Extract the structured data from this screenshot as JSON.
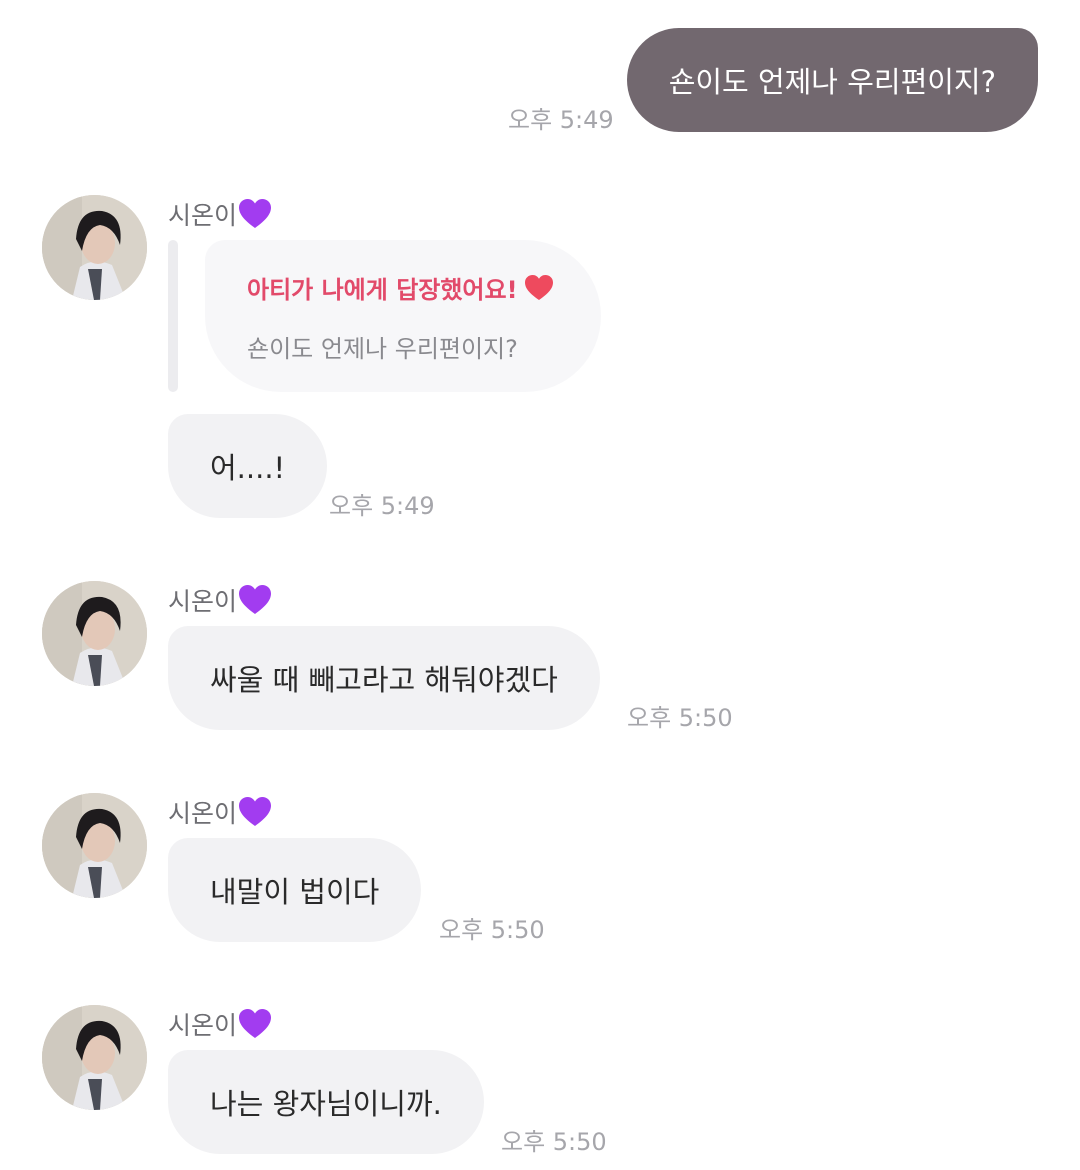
{
  "outgoing": {
    "text": "숀이도 언제나 우리편이지?",
    "time": "오후 5:49"
  },
  "sender_name": "시온이",
  "sender_emoji": "purple-heart-icon",
  "reply": {
    "title": "아티가 나에게 답장했어요!",
    "title_icon": "red-heart-icon",
    "quote": "숀이도 언제나 우리편이지?",
    "accent_color": "#e24a6a"
  },
  "messages": [
    {
      "text": "어....!",
      "time": "오후 5:49"
    },
    {
      "text": "싸울 때 빼고라고 해둬야겠다",
      "time": "오후 5:50"
    },
    {
      "text": "내말이 법이다",
      "time": "오후 5:50"
    },
    {
      "text": "나는 왕자님이니까.",
      "time": "오후 5:50"
    }
  ],
  "colors": {
    "outgoing_bubble": "#72686f",
    "incoming_bubble": "#f2f2f4",
    "purple_heart": "#a23cf0"
  }
}
